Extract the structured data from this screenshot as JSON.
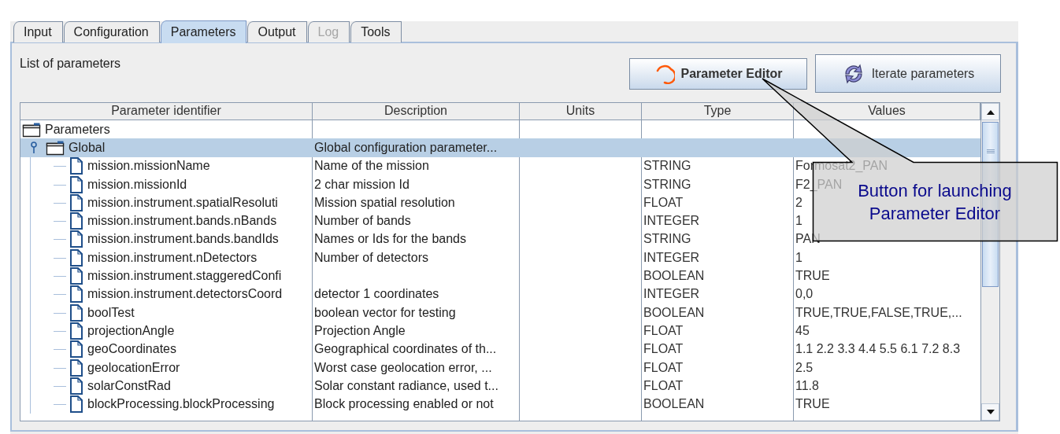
{
  "tabs": [
    {
      "label": "Input",
      "selected": false,
      "disabled": false
    },
    {
      "label": "Configuration",
      "selected": false,
      "disabled": false
    },
    {
      "label": "Parameters",
      "selected": true,
      "disabled": false
    },
    {
      "label": "Output",
      "selected": false,
      "disabled": false
    },
    {
      "label": "Log",
      "selected": false,
      "disabled": true
    },
    {
      "label": "Tools",
      "selected": false,
      "disabled": false
    }
  ],
  "panel_title": "List of parameters",
  "buttons": [
    {
      "label": "Parameter Editor",
      "kind": "editor"
    },
    {
      "label": "Iterate parameters",
      "kind": "iterate"
    }
  ],
  "table": {
    "columns": [
      "Parameter identifier",
      "Description",
      "Units",
      "Type",
      "Values"
    ],
    "tree": [
      {
        "identifier": "Parameters",
        "kind": "folder",
        "children": [
          {
            "identifier": "Global",
            "kind": "folder",
            "expanded": true,
            "selected": true,
            "description": "Global configuration parameter...",
            "children": [
              {
                "identifier": "mission.missionName",
                "kind": "file",
                "selected": false,
                "description": "Name of the mission",
                "type": "STRING",
                "values": "Formosat2_PAN"
              },
              {
                "identifier": "mission.missionId",
                "kind": "file",
                "selected": false,
                "description": "2 char mission Id",
                "type": "STRING",
                "values": "F2_PAN"
              },
              {
                "identifier": "mission.instrument.spatialResoluti",
                "kind": "file",
                "selected": false,
                "description": "Mission spatial resolution",
                "type": "FLOAT",
                "values": "2"
              },
              {
                "identifier": "mission.instrument.bands.nBands",
                "kind": "file",
                "selected": false,
                "description": "Number of bands",
                "type": "INTEGER",
                "values": "1"
              },
              {
                "identifier": "mission.instrument.bands.bandIds",
                "kind": "file",
                "selected": false,
                "description": "Names or Ids for the bands",
                "type": "STRING",
                "values": "PAN"
              },
              {
                "identifier": "mission.instrument.nDetectors",
                "kind": "file",
                "selected": false,
                "description": "Number of detectors",
                "type": "INTEGER",
                "values": "1"
              },
              {
                "identifier": "mission.instrument.staggeredConfi",
                "kind": "file",
                "selected": false,
                "type": "BOOLEAN",
                "values": "TRUE"
              },
              {
                "identifier": "mission.instrument.detectorsCoord",
                "kind": "file",
                "selected": false,
                "description": "detector 1 coordinates",
                "type": "INTEGER",
                "values": "0,0"
              },
              {
                "identifier": "boolTest",
                "kind": "file",
                "selected": false,
                "description": "boolean vector for testing",
                "type": "BOOLEAN",
                "values": "TRUE,TRUE,FALSE,TRUE,..."
              },
              {
                "identifier": "projectionAngle",
                "kind": "file",
                "selected": false,
                "description": "Projection Angle",
                "type": "FLOAT",
                "values": "45"
              },
              {
                "identifier": "geoCoordinates",
                "kind": "file",
                "selected": false,
                "description": "Geographical coordinates of th...",
                "type": "FLOAT",
                "values": "1.1 2.2 3.3 4.4 5.5 6.1 7.2 8.3"
              },
              {
                "identifier": "geolocationError",
                "kind": "file",
                "selected": false,
                "description": "Worst case geolocation error, ...",
                "type": "FLOAT",
                "values": "2.5"
              },
              {
                "identifier": "solarConstRad",
                "kind": "file",
                "selected": false,
                "description": "Solar constant radiance, used t...",
                "type": "FLOAT",
                "values": "11.8"
              },
              {
                "identifier": "blockProcessing.blockProcessing",
                "kind": "file",
                "selected": false,
                "description": "Block processing enabled or not",
                "type": "BOOLEAN",
                "values": "TRUE"
              }
            ]
          }
        ]
      }
    ]
  },
  "callout": {
    "text": "Button for launching Parameter Editor"
  }
}
